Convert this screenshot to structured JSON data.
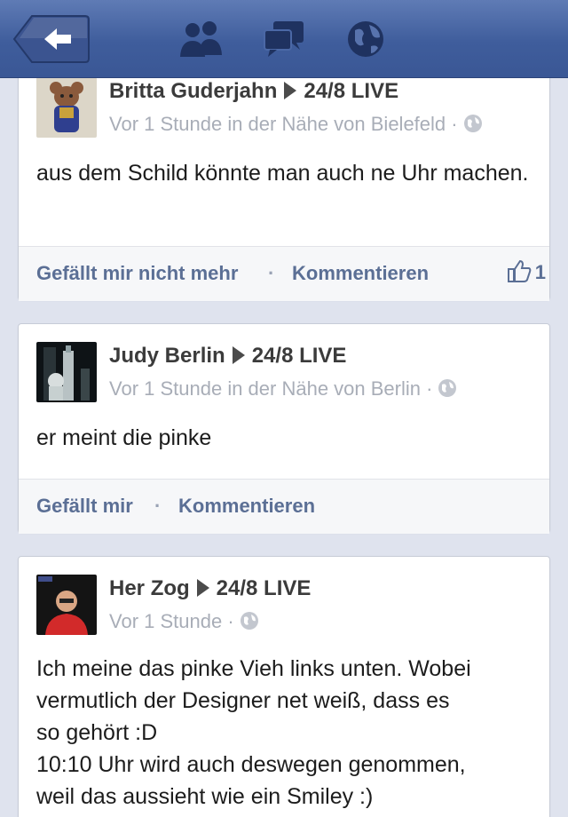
{
  "topbar": {
    "back_icon": "back-arrow-icon",
    "friends_icon": "friend-requests-icon",
    "messages_icon": "messages-icon",
    "notifications_icon": "globe-notifications-icon"
  },
  "colors": {
    "bar": "#3b5998",
    "link": "#5b6f95",
    "meta": "#a8adb7",
    "background": "#dfe3ee"
  },
  "posts": [
    {
      "author": "Britta Guderjahn",
      "target": "24/8 LIVE",
      "meta": "Vor 1 Stunde in der Nähe von Bielefeld ·",
      "text": "aus dem Schild könnte man auch ne Uhr machen.",
      "like_label": "Gefällt mir nicht mehr",
      "comment_label": "Kommentieren",
      "like_count": "1"
    },
    {
      "author": "Judy Berlin",
      "target": "24/8 LIVE",
      "meta": "Vor 1 Stunde in der Nähe von Berlin ·",
      "text": "er meint die pinke",
      "like_label": "Gefällt mir",
      "comment_label": "Kommentieren"
    },
    {
      "author": "Her Zog",
      "target": "24/8 LIVE",
      "meta": "Vor 1 Stunde ·",
      "text_lines": [
        "Ich meine das pinke Vieh links unten. Wobei",
        "vermutlich der Designer net weiß, dass es",
        "so gehört :D",
        "10:10 Uhr wird auch deswegen genommen,",
        "weil das aussieht wie ein Smiley :)"
      ]
    }
  ]
}
